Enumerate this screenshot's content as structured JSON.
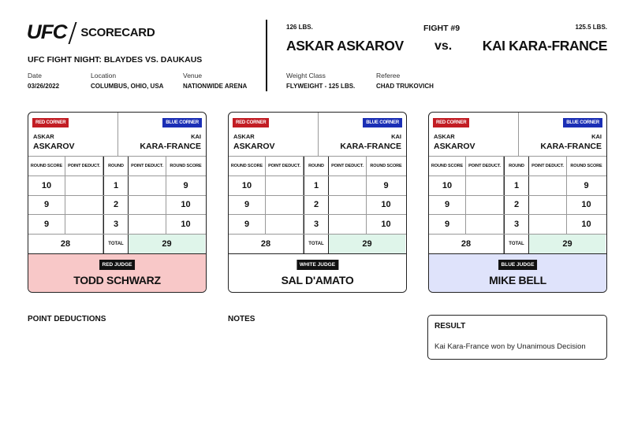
{
  "header": {
    "logo_text": "UFC",
    "title": "SCORECARD",
    "event": "UFC FIGHT NIGHT: BLAYDES VS. DAUKAUS",
    "date_label": "Date",
    "date": "03/26/2022",
    "location_label": "Location",
    "location": "COLUMBUS, OHIO, USA",
    "venue_label": "Venue",
    "venue": "NATIONWIDE ARENA"
  },
  "fight": {
    "number": "FIGHT #9",
    "red_weight": "126 LBS.",
    "red_name": "ASKAR ASKAROV",
    "vs": "vs.",
    "blue_weight": "125.5 LBS.",
    "blue_name": "KAI KARA-FRANCE",
    "weight_class_label": "Weight Class",
    "weight_class": "FLYWEIGHT - 125 LBS.",
    "referee_label": "Referee",
    "referee": "CHAD TRUKOVICH"
  },
  "labels": {
    "red_corner": "RED CORNER",
    "blue_corner": "BLUE CORNER",
    "red_first": "ASKAR",
    "red_last": "ASKAROV",
    "blue_first": "KAI",
    "blue_last": "KARA-FRANCE",
    "round_score": "ROUND SCORE",
    "point_deduct": "POINT DEDUCT.",
    "round": "ROUND",
    "total": "TOTAL"
  },
  "cards": [
    {
      "judge_tag": "RED JUDGE",
      "judge": "TODD SCHWARZ",
      "rounds": [
        {
          "red": "10",
          "red_pd": "",
          "round": "1",
          "blue_pd": "",
          "blue": "9"
        },
        {
          "red": "9",
          "red_pd": "",
          "round": "2",
          "blue_pd": "",
          "blue": "10"
        },
        {
          "red": "9",
          "red_pd": "",
          "round": "3",
          "blue_pd": "",
          "blue": "10"
        }
      ],
      "red_total": "28",
      "blue_total": "29",
      "judge_bg": "#f8c8c8"
    },
    {
      "judge_tag": "WHITE JUDGE",
      "judge": "SAL D'AMATO",
      "rounds": [
        {
          "red": "10",
          "red_pd": "",
          "round": "1",
          "blue_pd": "",
          "blue": "9"
        },
        {
          "red": "9",
          "red_pd": "",
          "round": "2",
          "blue_pd": "",
          "blue": "10"
        },
        {
          "red": "9",
          "red_pd": "",
          "round": "3",
          "blue_pd": "",
          "blue": "10"
        }
      ],
      "red_total": "28",
      "blue_total": "29",
      "judge_bg": "#ffffff"
    },
    {
      "judge_tag": "BLUE JUDGE",
      "judge": "MIKE BELL",
      "rounds": [
        {
          "red": "10",
          "red_pd": "",
          "round": "1",
          "blue_pd": "",
          "blue": "9"
        },
        {
          "red": "9",
          "red_pd": "",
          "round": "2",
          "blue_pd": "",
          "blue": "10"
        },
        {
          "red": "9",
          "red_pd": "",
          "round": "3",
          "blue_pd": "",
          "blue": "10"
        }
      ],
      "red_total": "28",
      "blue_total": "29",
      "judge_bg": "#dfe3fb"
    }
  ],
  "footer": {
    "point_deductions": "POINT DEDUCTIONS",
    "notes": "NOTES",
    "result_title": "RESULT",
    "result": "Kai Kara-France won by Unanimous Decision"
  },
  "colors": {
    "red": "#c21d24",
    "blue": "#1b2fb5",
    "total_green": "#dff5ea"
  }
}
